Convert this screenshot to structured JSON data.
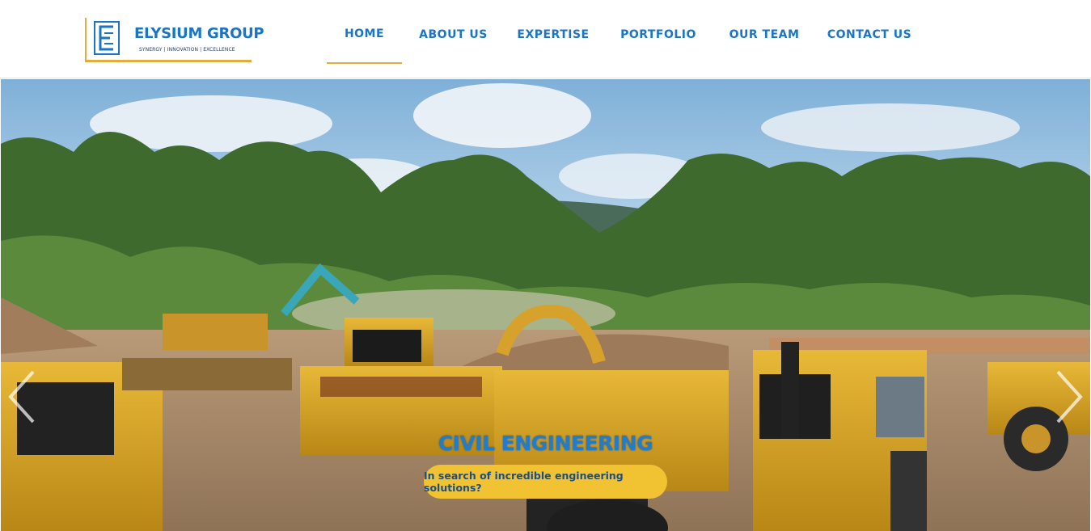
{
  "brand": {
    "name": "ELYSIUM GROUP",
    "tagline": "SYNERGY | INNOVATION | EXCELLENCE",
    "accent_color": "#e2ad3f",
    "primary_color": "#1a75c4"
  },
  "nav": {
    "items": [
      {
        "label": "HOME",
        "active": true
      },
      {
        "label": "ABOUT US",
        "active": false
      },
      {
        "label": "EXPERTISE",
        "active": false
      },
      {
        "label": "PORTFOLIO",
        "active": false
      },
      {
        "label": "OUR TEAM",
        "active": false
      },
      {
        "label": "CONTACT US",
        "active": false
      }
    ]
  },
  "hero": {
    "image_icon": "construction-site-photo",
    "title": "CIVIL ENGINEERING",
    "cta_label": "In search of incredible engineering solutions?",
    "prev_icon": "chevron-left-icon",
    "next_icon": "chevron-right-icon"
  }
}
